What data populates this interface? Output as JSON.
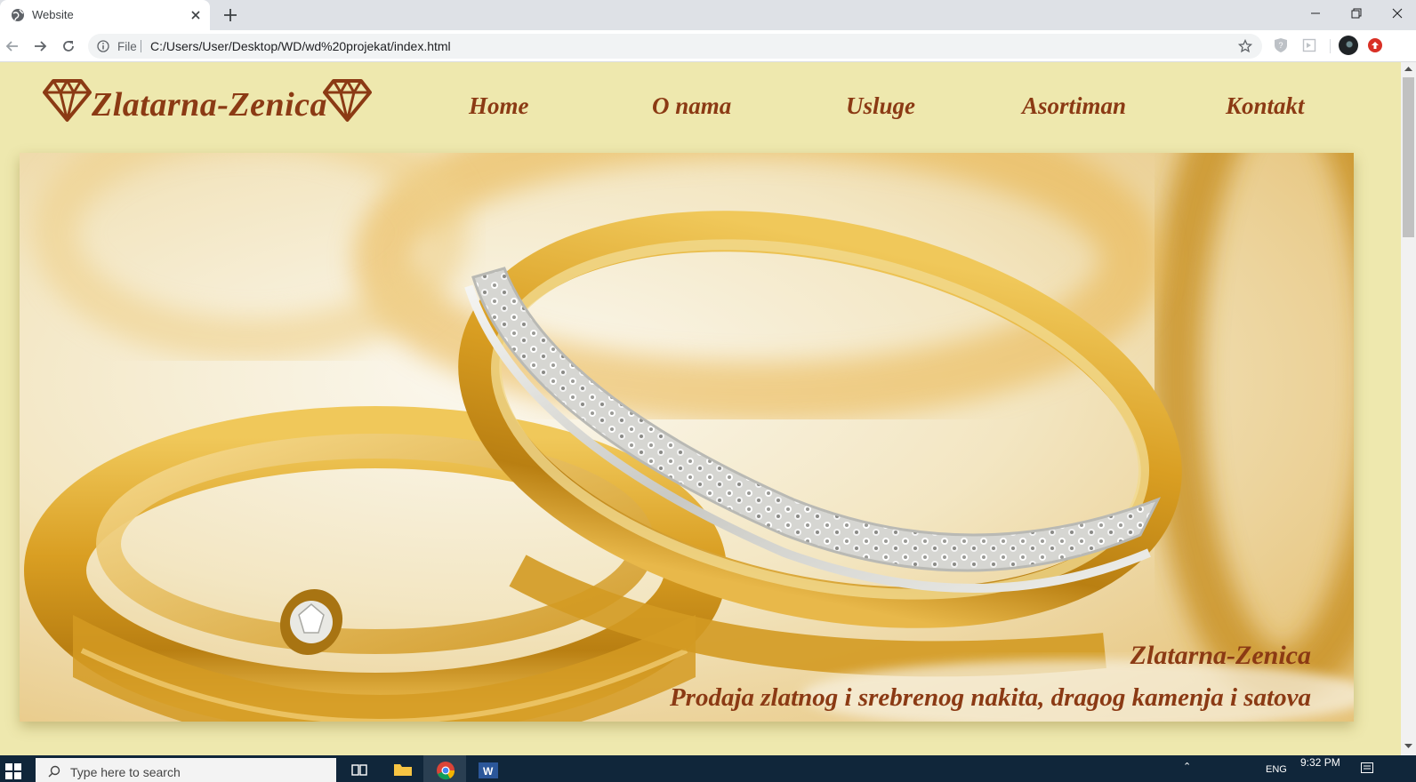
{
  "browser": {
    "tab": {
      "title": "Website",
      "favicon": "globe-icon"
    },
    "address": {
      "scheme_label": "File",
      "url": "C:/Users/User/Desktop/WD/wd%20projekat/index.html"
    }
  },
  "site": {
    "logo_text": "Zlatarna-Zenica",
    "nav": [
      "Home",
      "O nama",
      "Usluge",
      "Asortiman",
      "Kontakt"
    ],
    "hero": {
      "title": "Zlatarna-Zenica",
      "subtitle": "Prodaja zlatnog i srebrenog nakita, dragog kamenja i satova"
    }
  },
  "taskbar": {
    "search_placeholder": "Type here to search",
    "language": "ENG",
    "time": "9:32 PM"
  },
  "colors": {
    "page_background": "#eee8ae",
    "brand_brown": "#8b3a14",
    "gold": "#d9a520",
    "taskbar": "#10263a"
  }
}
